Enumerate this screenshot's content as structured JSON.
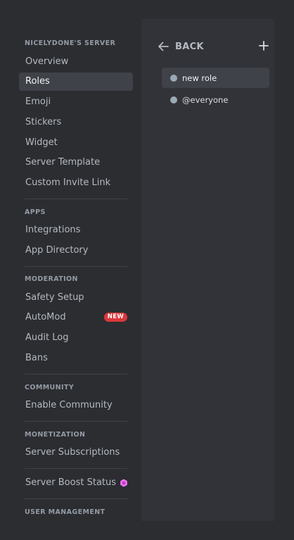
{
  "sidebar": {
    "sections": [
      {
        "header": "NICELYDONE'S SERVER",
        "items": [
          "Overview",
          "Roles",
          "Emoji",
          "Stickers",
          "Widget",
          "Server Template",
          "Custom Invite Link"
        ]
      },
      {
        "header": "APPS",
        "items": [
          "Integrations",
          "App Directory"
        ]
      },
      {
        "header": "MODERATION",
        "items": [
          "Safety Setup",
          "AutoMod",
          "Audit Log",
          "Bans"
        ]
      },
      {
        "header": "COMMUNITY",
        "items": [
          "Enable Community"
        ]
      },
      {
        "header": "MONETIZATION",
        "items": [
          "Server Subscriptions"
        ]
      },
      {
        "items": [
          "Server Boost Status"
        ]
      },
      {
        "header": "USER MANAGEMENT"
      }
    ],
    "selected_item": "Roles",
    "automod_badge": "NEW",
    "boost_icon": "boost-gem-icon"
  },
  "roles_panel": {
    "back_label": "BACK",
    "back_icon": "arrow-left-icon",
    "add_icon": "plus-icon",
    "roles": [
      {
        "name": "new role",
        "selected": true
      },
      {
        "name": "@everyone",
        "selected": false
      }
    ],
    "role_dot_color": "#99aab5"
  },
  "colors": {
    "background": "#2b2d31",
    "panel": "#313338",
    "selected": "#404249",
    "text_muted": "#949ba4",
    "text_normal": "#b5bac1",
    "badge_red": "#da373c",
    "boost_pink": "#ff73fa"
  }
}
